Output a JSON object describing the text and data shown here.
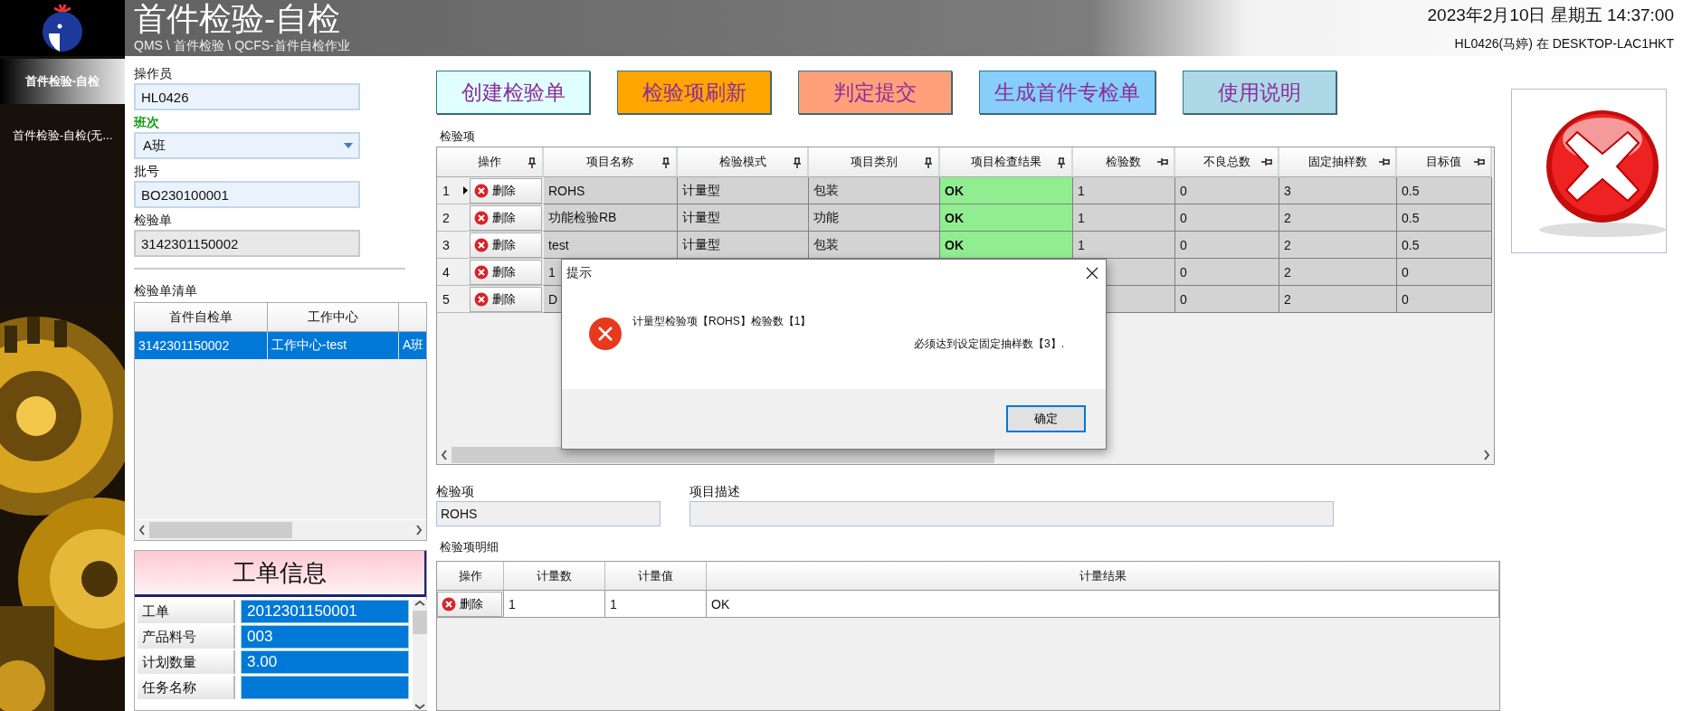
{
  "sidebar": {
    "items": [
      {
        "label": "首件检验-自检",
        "selected": true
      },
      {
        "label": "首件检验-自检(无...",
        "selected": false
      }
    ]
  },
  "header": {
    "title": "首件检验-自检",
    "breadcrumb": "QMS \\ 首件检验 \\ QCFS-首件自检作业",
    "datetime": "2023年2月10日 星期五 14:37:00",
    "user": "HL0426(马婷) 在 DESKTOP-LAC1HKT"
  },
  "form": {
    "fields": [
      {
        "label": "操作员",
        "value": "HL0426",
        "kind": "text",
        "highlighted": false,
        "readonly": false
      },
      {
        "label": "班次",
        "value": "A班",
        "kind": "dropdown",
        "highlighted": true,
        "readonly": false
      },
      {
        "label": "批号",
        "value": "BO230100001",
        "kind": "text",
        "highlighted": false,
        "readonly": false
      },
      {
        "label": "检验单",
        "value": "3142301150002",
        "kind": "text",
        "highlighted": false,
        "readonly": true
      }
    ]
  },
  "order_list": {
    "title": "检验单清单",
    "columns": [
      "首件自检单",
      "工作中心"
    ],
    "rows": [
      {
        "cells": [
          "3142301150002",
          "工作中心-test",
          "A班"
        ],
        "selected": true
      }
    ]
  },
  "work_order": {
    "title": "工单信息",
    "rows": [
      {
        "label": "工单",
        "value": "2012301150001"
      },
      {
        "label": "产品料号",
        "value": "003"
      },
      {
        "label": "计划数量",
        "value": "3.00"
      },
      {
        "label": "任务名称"
      }
    ]
  },
  "toolbar": {
    "buttons": [
      {
        "label": "创建检验单",
        "color": "#e0ffff"
      },
      {
        "label": "检验项刷新",
        "color": "#ffa500"
      },
      {
        "label": "判定提交",
        "color": "#ffa07a"
      },
      {
        "label": "生成首件专检单",
        "color": "#87cefa"
      },
      {
        "label": "使用说明",
        "color": "#add8e6"
      }
    ]
  },
  "inspection_items": {
    "title": "检验项",
    "columns": [
      {
        "label": "操作",
        "pinned": true
      },
      {
        "label": "项目名称",
        "pinned": true
      },
      {
        "label": "检验模式",
        "pinned": true
      },
      {
        "label": "项目类别",
        "pinned": true
      },
      {
        "label": "项目检查结果",
        "pinned": true
      },
      {
        "label": "检验数",
        "pinned": false
      },
      {
        "label": "不良总数",
        "pinned": false
      },
      {
        "label": "固定抽样数",
        "pinned": false
      },
      {
        "label": "目标值",
        "pinned": false
      }
    ],
    "rows": [
      {
        "index": "1",
        "current": true,
        "action": "删除",
        "cells": [
          "ROHS",
          "计量型",
          "包装",
          "OK",
          "1",
          "0",
          "3",
          "0.5"
        ]
      },
      {
        "index": "2",
        "current": false,
        "action": "删除",
        "cells": [
          "功能检验RB",
          "计量型",
          "功能",
          "OK",
          "1",
          "0",
          "2",
          "0.5"
        ]
      },
      {
        "index": "3",
        "current": false,
        "action": "删除",
        "cells": [
          "test",
          "计量型",
          "包装",
          "OK",
          "1",
          "0",
          "2",
          "0.5"
        ]
      },
      {
        "index": "4",
        "current": false,
        "action": "删除",
        "cells": [
          "1",
          null,
          null,
          null,
          null,
          "0",
          "2",
          "0"
        ]
      },
      {
        "index": "5",
        "current": false,
        "action": "删除",
        "cells": [
          "D",
          null,
          null,
          null,
          null,
          "0",
          "2",
          "0"
        ]
      }
    ]
  },
  "dialog": {
    "title": "提示",
    "lines": [
      "计量型检验项【ROHS】检验数【1】",
      "必须达到设定固定抽样数【3】."
    ],
    "ok_button": "确定"
  },
  "detail": {
    "item_label": "检验项",
    "item_value": "ROHS",
    "desc_label": "项目描述",
    "title": "检验项明细",
    "columns": [
      "操作",
      "计量数",
      "计量值",
      "计量结果"
    ],
    "rows": [
      {
        "action": "删除",
        "cells": [
          "1",
          "1",
          "OK"
        ]
      }
    ]
  }
}
